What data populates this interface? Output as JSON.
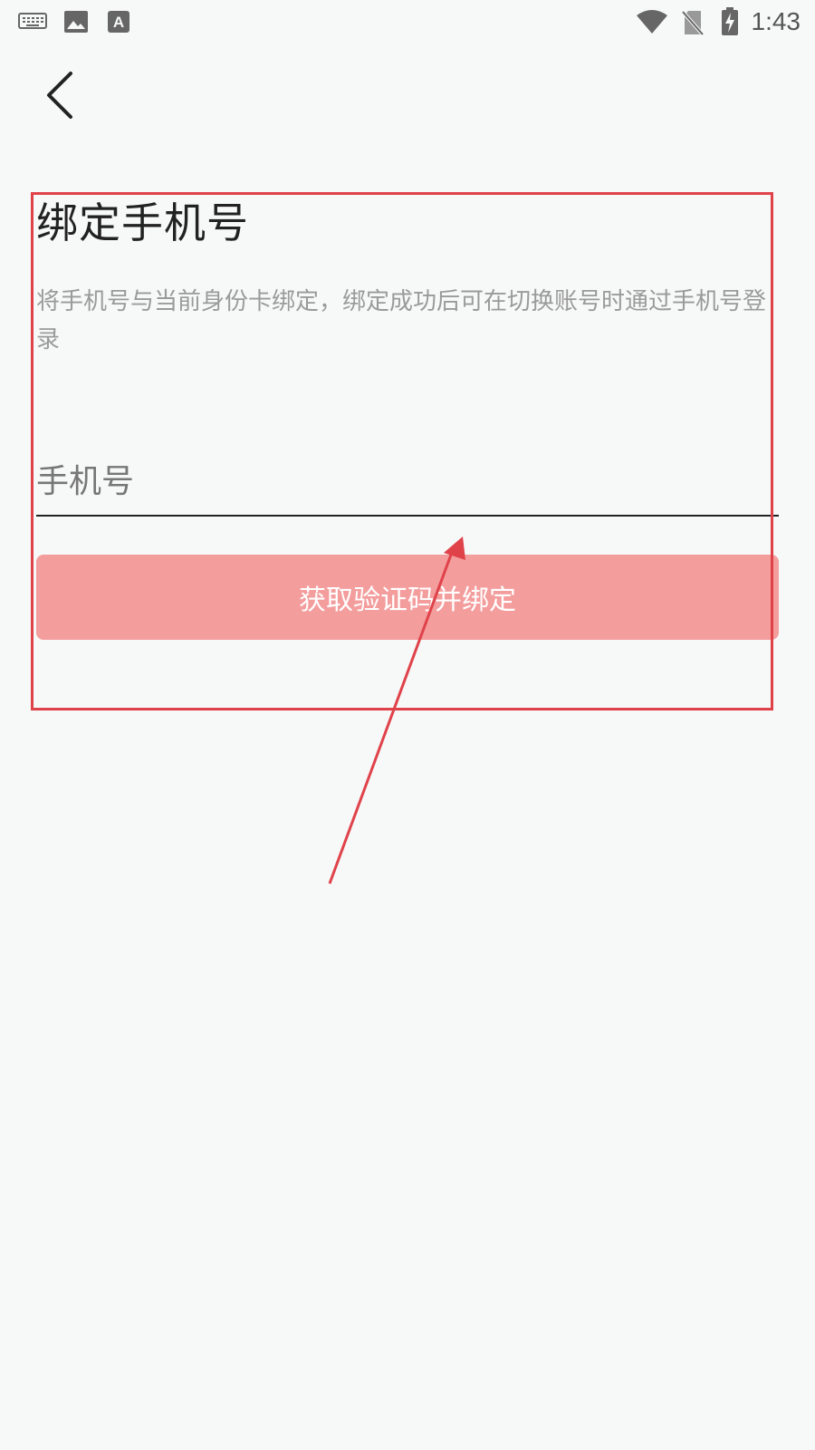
{
  "status_bar": {
    "time": "1:43",
    "icons": [
      "keyboard-icon",
      "image-icon",
      "font-icon",
      "wifi-icon",
      "no-sim-icon",
      "battery-charging-icon"
    ]
  },
  "header": {
    "back_icon": "chevron-left-icon"
  },
  "main": {
    "title": "绑定手机号",
    "description": "将手机号与当前身份卡绑定，绑定成功后可在切换账号时通过手机号登录",
    "phone_placeholder": "手机号",
    "phone_value": "",
    "submit_label": "获取验证码并绑定"
  },
  "colors": {
    "background": "#f7f8f8",
    "button": "#f49d9d",
    "annotation": "#e0424a",
    "title": "#222222",
    "description": "#9a9a9a"
  }
}
